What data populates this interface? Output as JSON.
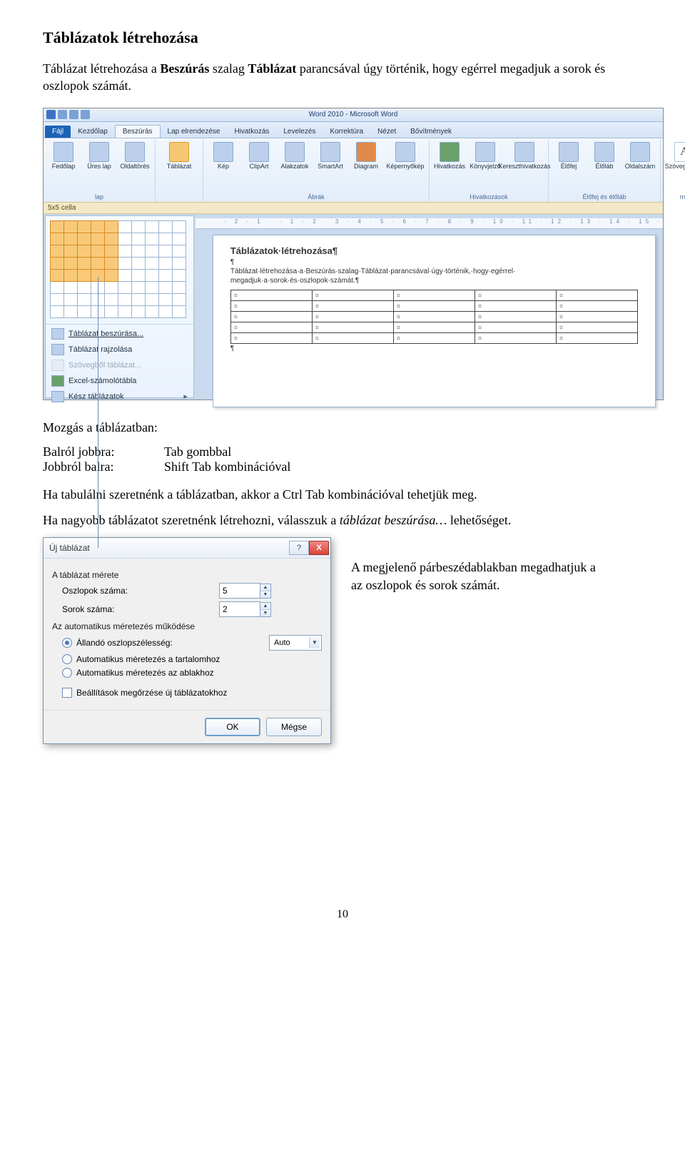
{
  "heading": "Táblázatok létrehozása",
  "intro_pre": "Táblázat létrehozása a ",
  "intro_b1": "Beszúrás",
  "intro_mid": " szalag ",
  "intro_b2": "Táblázat",
  "intro_post": " parancsával úgy történik, hogy egérrel megadjuk a sorok és oszlopok számát.",
  "word": {
    "title": "Word 2010 - Microsoft Word",
    "tabs": {
      "file": "Fájl",
      "home": "Kezdőlap",
      "insert": "Beszúrás",
      "layout": "Lap elrendezése",
      "ref": "Hivatkozás",
      "mail": "Levelezés",
      "review": "Korrektúra",
      "view": "Nézet",
      "add": "Bővítmények"
    },
    "ribbon": {
      "pages": {
        "cover": "Fedőlap",
        "blank": "Üres lap",
        "break": "Oldaltörés",
        "group": "lap"
      },
      "table": {
        "btn": "Táblázat",
        "group": ""
      },
      "ill": {
        "pic": "Kép",
        "clip": "ClipArt",
        "shapes": "Alakzatok",
        "smart": "SmartArt",
        "chart": "Diagram",
        "shot": "Képernyőkép",
        "group": "Ábrák"
      },
      "links": {
        "hyper": "Hivatkozás",
        "book": "Könyvjelző",
        "cross": "Kereszthivatkozás",
        "group": "Hivatkozások"
      },
      "hdr": {
        "header": "Élőfej",
        "footer": "Élőláb",
        "num": "Oldalszám",
        "group": "Élőfej és élőláb"
      },
      "text": {
        "box": "Szövegdoboz",
        "group": "mo",
        "A": "A"
      }
    },
    "cellinfo": "5x5 cella",
    "panel": {
      "insert": "Táblázat beszúrása...",
      "draw": "Táblázat rajzolása",
      "convert": "Szövegből táblázat...",
      "excel": "Excel-számolótábla",
      "quick": "Kész táblázatok"
    },
    "doc": {
      "h": "Táblázatok·létrehozása¶",
      "p": "Táblázat·létrehozása·a·Beszúrás·szalag·Táblázat·parancsával·úgy·történik,·hogy·egérrel· megadjuk·a·sorok·és·oszlopok·számát.¶",
      "cell": "¤"
    },
    "ruler": "· 2 · 1 · · 1 · 2 · 3 · 4 · 5 · 6 · 7 · 8 · 9 · 10 · 11 · 12 · 13 · 14 · 15 ·"
  },
  "mv_title": "Mozgás a táblázatban:",
  "mv_l1": "Balról jobbra:",
  "mv_r1": "Tab gombbal",
  "mv_l2": "Jobbról balra:",
  "mv_r2": "Shift Tab kombinációval",
  "tabline": "Ha tabulálni szeretnénk a táblázatban, akkor a Ctrl Tab kombinációval tehetjük meg.",
  "big_pre": "Ha nagyobb táblázatot szeretnénk létrehozni, válasszuk a ",
  "big_it": "táblázat beszúrása…",
  "big_post": " lehetőséget.",
  "dlg": {
    "title": "Új táblázat",
    "help": "?",
    "close": "X",
    "sec1": "A táblázat mérete",
    "cols_l": "Oszlopok száma:",
    "cols_v": "5",
    "rows_l": "Sorok száma:",
    "rows_v": "2",
    "sec2": "Az automatikus méretezés működése",
    "r1": "Állandó oszlopszélesség:",
    "r1v": "Auto",
    "r2": "Automatikus méretezés a tartalomhoz",
    "r3": "Automatikus méretezés az ablakhoz",
    "chk": "Beállítások megőrzése új táblázatokhoz",
    "ok": "OK",
    "cancel": "Mégse"
  },
  "sidenote": "A megjelenő párbeszédablakban megadhatjuk a az oszlopok és sorok számát.",
  "pagenum": "10"
}
